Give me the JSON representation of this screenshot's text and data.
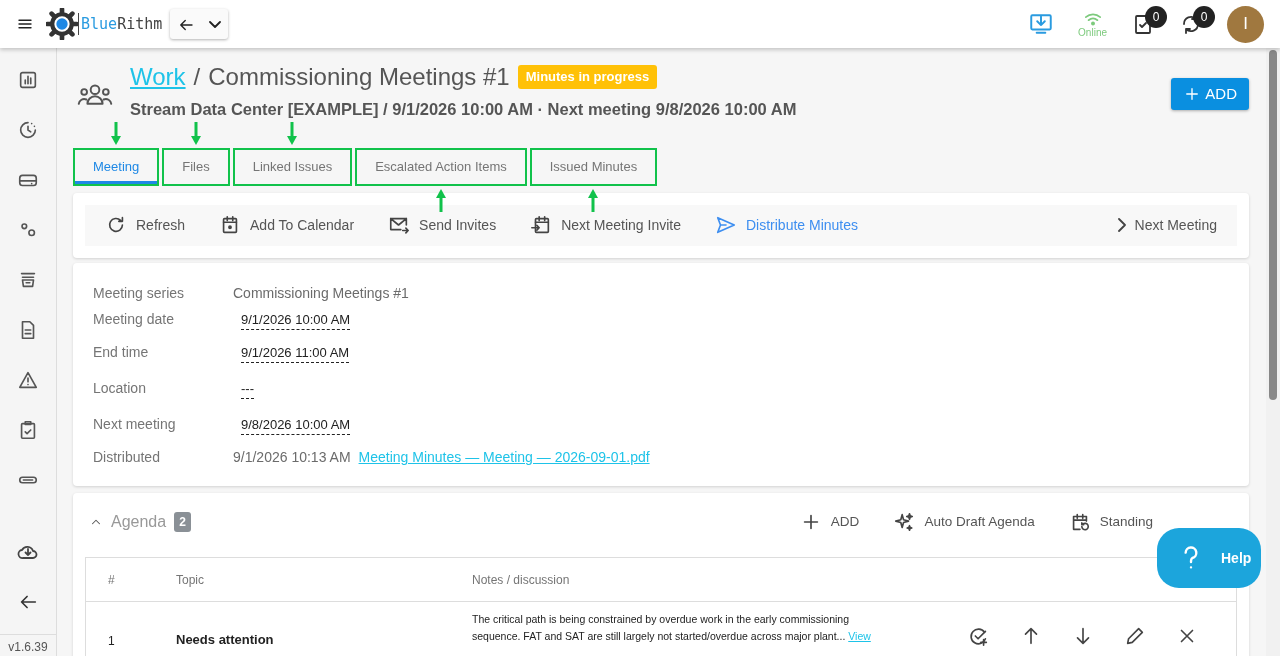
{
  "topbar": {
    "brand_lead": "Blue",
    "brand_tail": "Rithm",
    "online_status": "Online",
    "tasks_count": "0",
    "sync_count": "0",
    "avatar_initial": "I"
  },
  "header": {
    "breadcrumb": "Work",
    "separator": "/",
    "title": "Commissioning Meetings #1",
    "status_badge": "Minutes in progress",
    "subtitle": "Stream Data Center [EXAMPLE] / 9/1/2026 10:00 AM · Next meeting 9/8/2026 10:00 AM",
    "add_button": "ADD"
  },
  "tabs": [
    {
      "label": "Meeting",
      "selected": true,
      "arrow_above": true,
      "arrow_below": false
    },
    {
      "label": "Files",
      "selected": false,
      "arrow_above": true,
      "arrow_below": false
    },
    {
      "label": "Linked Issues",
      "selected": false,
      "arrow_above": true,
      "arrow_below": false
    },
    {
      "label": "Escalated Action Items",
      "selected": false,
      "arrow_above": false,
      "arrow_below": true
    },
    {
      "label": "Issued Minutes",
      "selected": false,
      "arrow_above": false,
      "arrow_below": true
    }
  ],
  "toolbar": {
    "actions": [
      {
        "label": "Refresh",
        "kind": "refresh",
        "highlighted": false
      },
      {
        "label": "Add To Calendar",
        "kind": "calendar",
        "highlighted": false
      },
      {
        "label": "Send Invites",
        "kind": "invite",
        "highlighted": false
      },
      {
        "label": "Next Meeting Invite",
        "kind": "next-invite",
        "highlighted": false
      },
      {
        "label": "Distribute Minutes",
        "kind": "distribute",
        "highlighted": true
      }
    ],
    "next_button": "Next Meeting"
  },
  "details": [
    {
      "label": "Meeting series",
      "value": "Commissioning Meetings #1",
      "kind": "plain"
    },
    {
      "label": "Meeting date",
      "value": "9/1/2026 10:00 AM",
      "kind": "editable"
    },
    {
      "label": "End time",
      "value": "9/1/2026 11:00 AM",
      "kind": "editable"
    },
    {
      "label": "Location",
      "value": "---",
      "kind": "editable"
    },
    {
      "label": "Next meeting",
      "value": "9/8/2026 10:00 AM",
      "kind": "editable"
    },
    {
      "label": "Distributed",
      "value": "9/1/2026 10:13 AM",
      "kind": "plain",
      "link": "Meeting Minutes — Meeting — 2026-09-01.pdf"
    }
  ],
  "agenda": {
    "title": "Agenda",
    "count": "2",
    "expanded": true,
    "actions": [
      {
        "label": "ADD",
        "kind": "add"
      },
      {
        "label": "Auto Draft Agenda",
        "kind": "auto-draft"
      },
      {
        "label": "Standing",
        "kind": "standing"
      }
    ],
    "columns": [
      "#",
      "Topic",
      "Notes / discussion"
    ],
    "rows": [
      {
        "number": "1",
        "topic": "Needs attention",
        "notes": "The critical path is being constrained by overdue work in the early commissioning sequence. FAT and SAT are still largely not started/overdue across major plant...",
        "link": "View"
      }
    ]
  },
  "help_button": "Help",
  "version": "v1.6.39"
}
